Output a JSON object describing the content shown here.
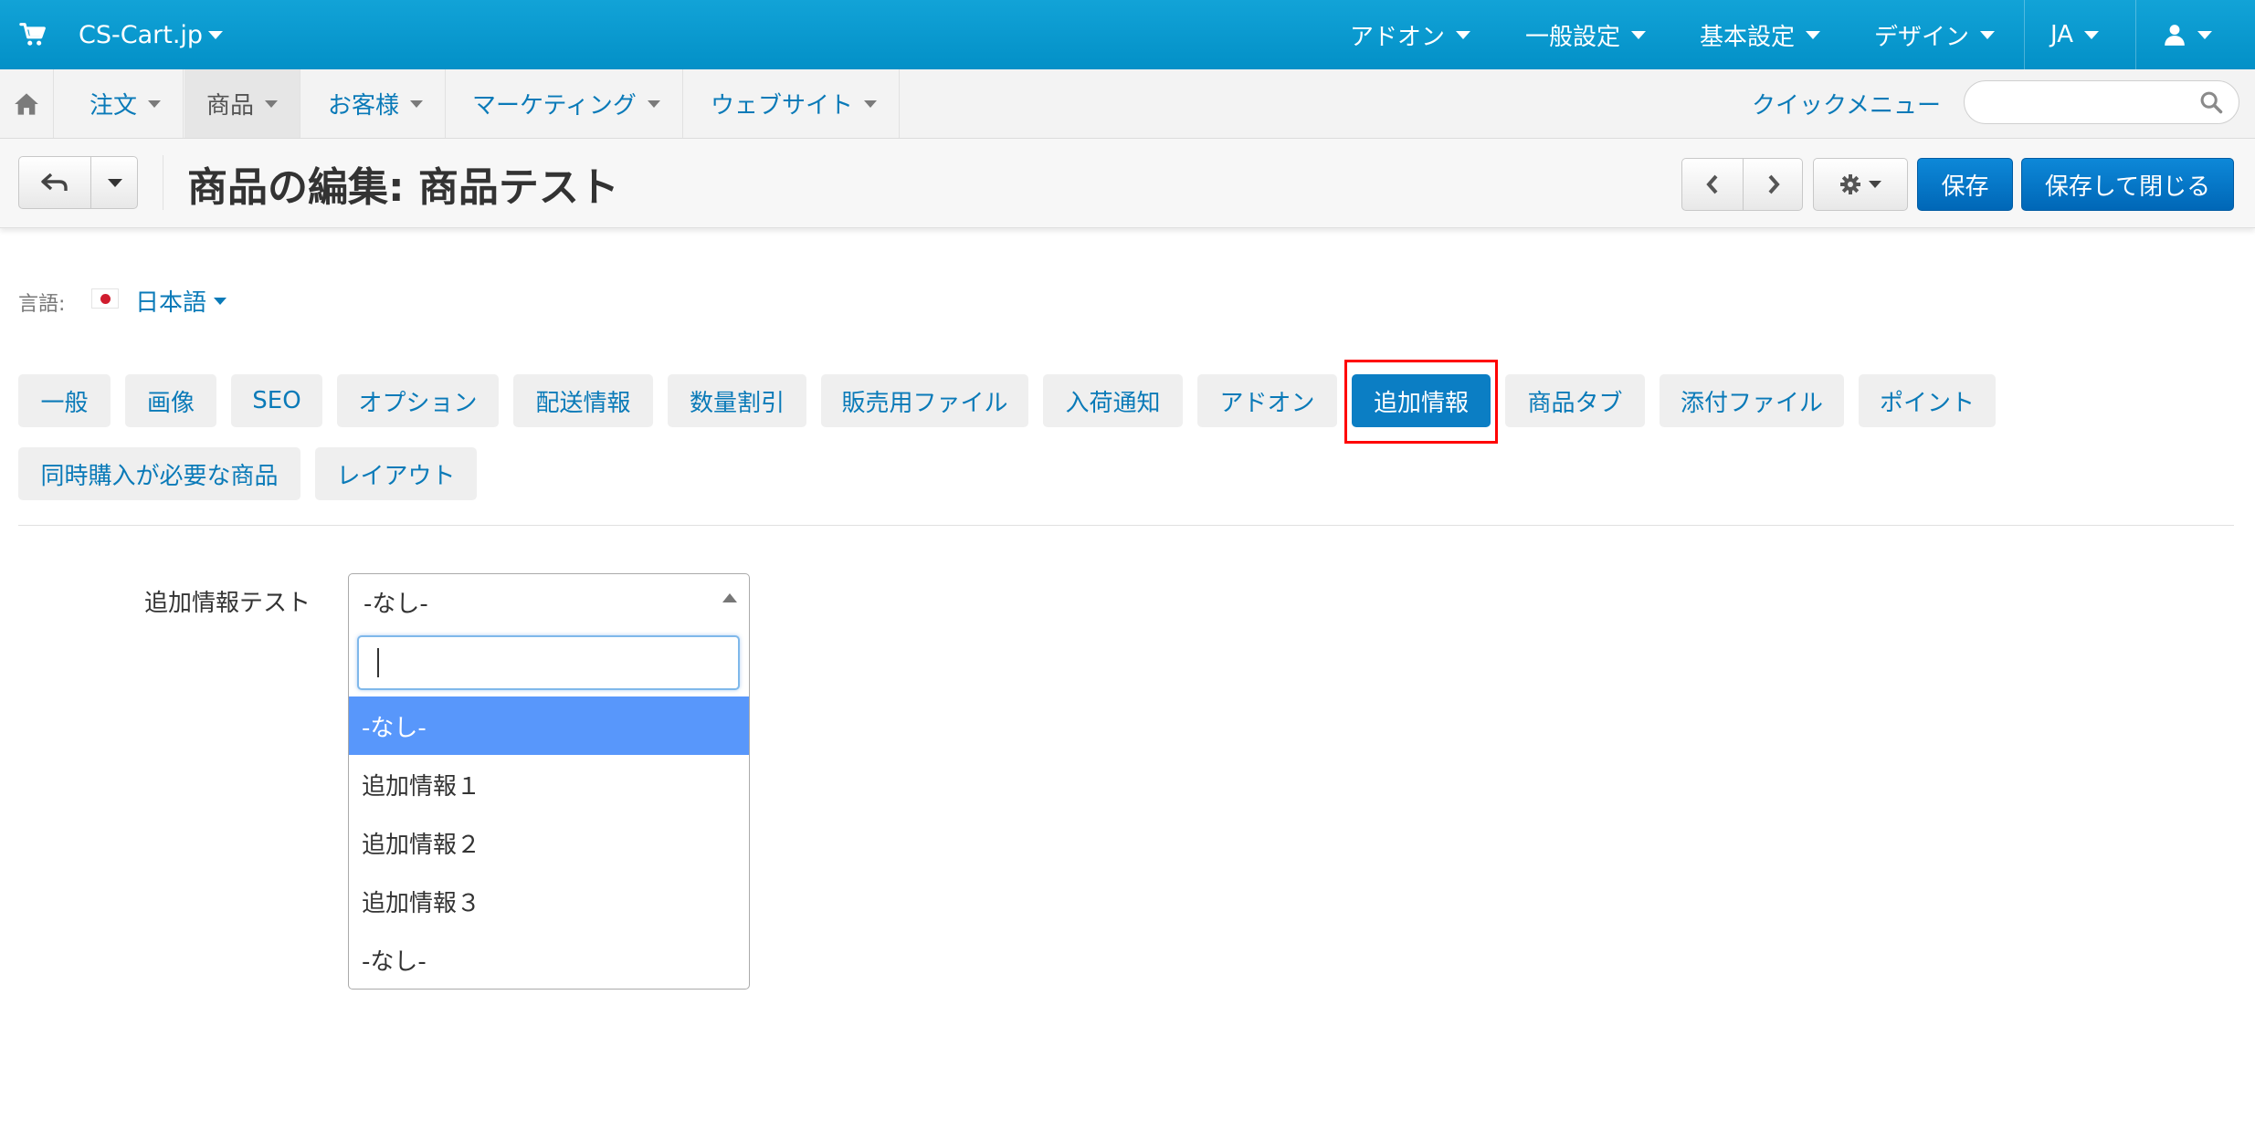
{
  "app": {
    "brand": "CS-Cart.jp",
    "accent_color": "#0b7ec4"
  },
  "topbar": {
    "menus": [
      {
        "label": "アドオン"
      },
      {
        "label": "一般設定"
      },
      {
        "label": "基本設定"
      },
      {
        "label": "デザイン"
      },
      {
        "label": "JA"
      }
    ],
    "user_icon": "user-icon"
  },
  "navbar": {
    "home_icon": "home-icon",
    "items": [
      {
        "label": "注文"
      },
      {
        "label": "商品",
        "active": true
      },
      {
        "label": "お客様"
      },
      {
        "label": "マーケティング"
      },
      {
        "label": "ウェブサイト"
      }
    ],
    "quick_menu": "クイックメニュー",
    "search_placeholder": ""
  },
  "header": {
    "title": "商品の編集: 商品テスト",
    "save_label": "保存",
    "save_close_label": "保存して閉じる"
  },
  "language": {
    "label": "言語:",
    "value": "日本語"
  },
  "tabs": [
    {
      "label": "一般"
    },
    {
      "label": "画像"
    },
    {
      "label": "SEO"
    },
    {
      "label": "オプション"
    },
    {
      "label": "配送情報"
    },
    {
      "label": "数量割引"
    },
    {
      "label": "販売用ファイル"
    },
    {
      "label": "入荷通知"
    },
    {
      "label": "アドオン"
    },
    {
      "label": "追加情報",
      "active": true
    },
    {
      "label": "商品タブ"
    },
    {
      "label": "添付ファイル"
    },
    {
      "label": "ポイント"
    },
    {
      "label": "同時購入が必要な商品"
    },
    {
      "label": "レイアウト"
    }
  ],
  "form": {
    "field_label": "追加情報テスト",
    "selected": "-なし-",
    "search_value": "",
    "options": [
      {
        "label": "-なし-",
        "highlighted": true
      },
      {
        "label": "追加情報１"
      },
      {
        "label": "追加情報２"
      },
      {
        "label": "追加情報３"
      },
      {
        "label": "-なし-"
      }
    ]
  }
}
